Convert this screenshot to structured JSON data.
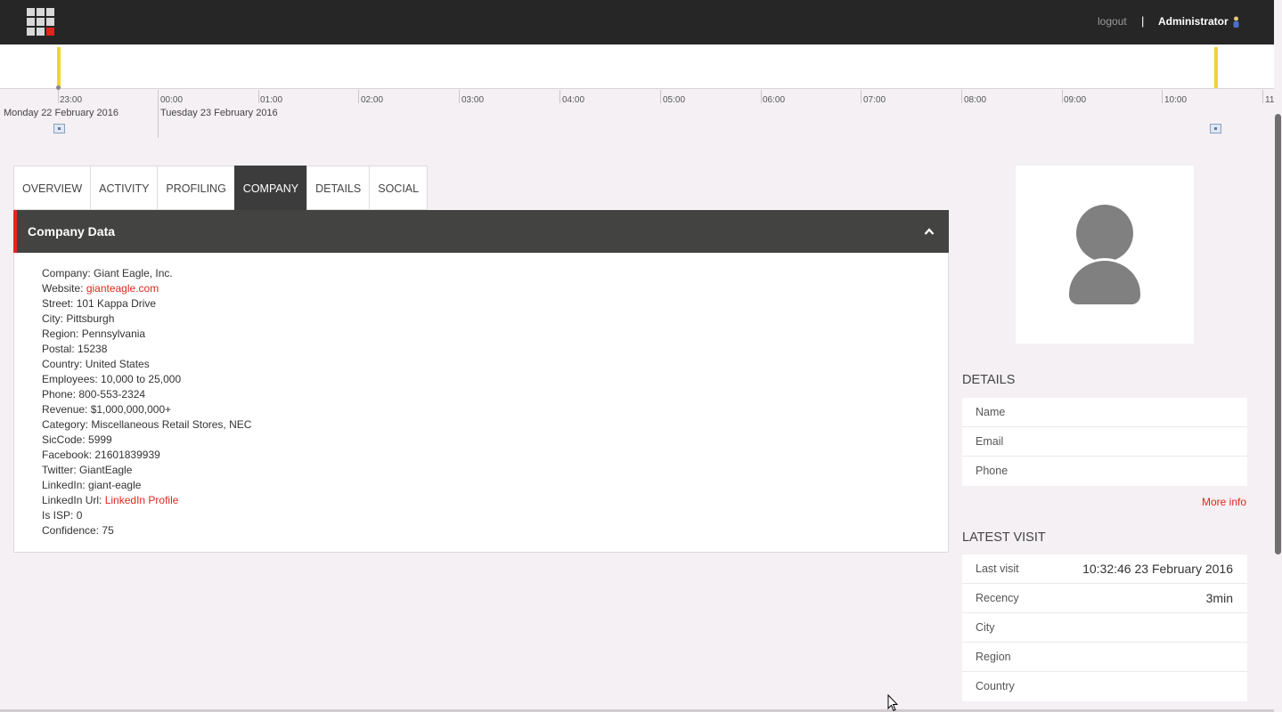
{
  "header": {
    "logout_label": "logout",
    "separator": "|",
    "user_name": "Administrator",
    "logo_icon": "grid-logo-icon"
  },
  "timeline": {
    "hours": [
      "23:00",
      "00:00",
      "01:00",
      "02:00",
      "03:00",
      "04:00",
      "05:00",
      "06:00",
      "07:00",
      "08:00",
      "09:00",
      "10:00",
      "11"
    ],
    "days": [
      "Monday 22 February 2016",
      "Tuesday 23 February 2016"
    ],
    "marker_color": "#f2d233"
  },
  "tabs": [
    {
      "label": "OVERVIEW",
      "active": false
    },
    {
      "label": "ACTIVITY",
      "active": false
    },
    {
      "label": "PROFILING",
      "active": false
    },
    {
      "label": "COMPANY",
      "active": true
    },
    {
      "label": "DETAILS",
      "active": false
    },
    {
      "label": "SOCIAL",
      "active": false
    }
  ],
  "company": {
    "title": "Company Data",
    "fields": [
      {
        "label": "Company: ",
        "value": "Giant Eagle, Inc."
      },
      {
        "label": "Website: ",
        "link": "gianteagle.com"
      },
      {
        "label": "Street: ",
        "value": "101 Kappa Drive"
      },
      {
        "label": "City: ",
        "value": "Pittsburgh"
      },
      {
        "label": "Region: ",
        "value": "Pennsylvania"
      },
      {
        "label": "Postal: ",
        "value": "15238"
      },
      {
        "label": "Country: ",
        "value": "United States"
      },
      {
        "label": "Employees: ",
        "value": "10,000 to 25,000"
      },
      {
        "label": "Phone: ",
        "value": "800-553-2324"
      },
      {
        "label": "Revenue: ",
        "value": "$1,000,000,000+"
      },
      {
        "label": "Category: ",
        "value": "Miscellaneous Retail Stores, NEC"
      },
      {
        "label": "SicCode: ",
        "value": "5999"
      },
      {
        "label": "Facebook: ",
        "value": "21601839939"
      },
      {
        "label": "Twitter: ",
        "value": "GiantEagle"
      },
      {
        "label": "LinkedIn: ",
        "value": "giant-eagle"
      },
      {
        "label": "LinkedIn Url: ",
        "link": "LinkedIn Profile"
      },
      {
        "label": "Is ISP: ",
        "value": "0"
      },
      {
        "label": "Confidence: ",
        "value": "75"
      }
    ]
  },
  "details": {
    "title": "DETAILS",
    "rows": [
      {
        "label": "Name",
        "value": ""
      },
      {
        "label": "Email",
        "value": ""
      },
      {
        "label": "Phone",
        "value": ""
      }
    ],
    "more_info": "More info"
  },
  "latest_visit": {
    "title": "LATEST VISIT",
    "rows": [
      {
        "label": "Last visit",
        "value": "10:32:46 23 February 2016"
      },
      {
        "label": "Recency",
        "value": "3min"
      },
      {
        "label": "City",
        "value": ""
      },
      {
        "label": "Region",
        "value": ""
      },
      {
        "label": "Country",
        "value": ""
      }
    ]
  },
  "colors": {
    "accent": "#e3261c",
    "topbar": "#262626",
    "panel_header": "#434341",
    "background": "#f4f0f4"
  }
}
